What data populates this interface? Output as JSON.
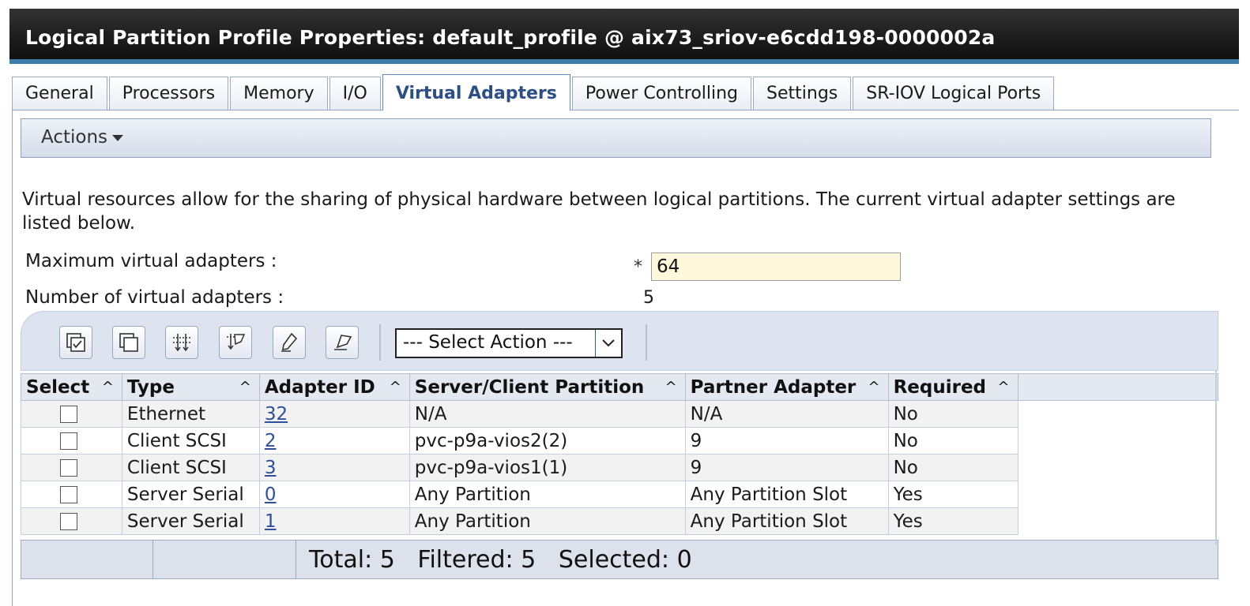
{
  "window": {
    "title": "Logical Partition Profile Properties: default_profile @ aix73_sriov-e6cdd198-0000002a"
  },
  "tabs": [
    {
      "label": "General"
    },
    {
      "label": "Processors"
    },
    {
      "label": "Memory"
    },
    {
      "label": "I/O"
    },
    {
      "label": "Virtual Adapters",
      "active": true
    },
    {
      "label": "Power Controlling"
    },
    {
      "label": "Settings"
    },
    {
      "label": "SR-IOV Logical Ports"
    }
  ],
  "actions_menu": {
    "label": "Actions"
  },
  "description": "Virtual resources allow for the sharing of physical hardware between logical partitions. The current virtual adapter settings are listed below.",
  "fields": {
    "max_label": "Maximum virtual adapters :",
    "required_marker": "*",
    "max_value": "64",
    "num_label": "Number of virtual adapters :",
    "num_value": "5"
  },
  "toolbar": {
    "icons": [
      "select-all-icon",
      "deselect-all-icon",
      "show-filter-row-icon",
      "clear-filters-icon",
      "edit-sort-icon",
      "clear-sorts-icon"
    ],
    "select_action": "--- Select Action ---"
  },
  "table": {
    "columns": [
      "Select",
      "Type",
      "Adapter ID",
      "Server/Client Partition",
      "Partner Adapter",
      "Required"
    ],
    "rows": [
      {
        "type": "Ethernet",
        "adapter_id": "32",
        "partition": "N/A",
        "partner": "N/A",
        "required": "No"
      },
      {
        "type": "Client SCSI",
        "adapter_id": "2",
        "partition": "pvc-p9a-vios2(2)",
        "partner": "9",
        "required": "No"
      },
      {
        "type": "Client SCSI",
        "adapter_id": "3",
        "partition": "pvc-p9a-vios1(1)",
        "partner": "9",
        "required": "No"
      },
      {
        "type": "Server Serial",
        "adapter_id": "0",
        "partition": "Any Partition",
        "partner": "Any Partition Slot",
        "required": "Yes"
      },
      {
        "type": "Server Serial",
        "adapter_id": "1",
        "partition": "Any Partition",
        "partner": "Any Partition Slot",
        "required": "Yes"
      }
    ]
  },
  "footer": {
    "stats": "Total: 5   Filtered: 5   Selected: 0"
  }
}
